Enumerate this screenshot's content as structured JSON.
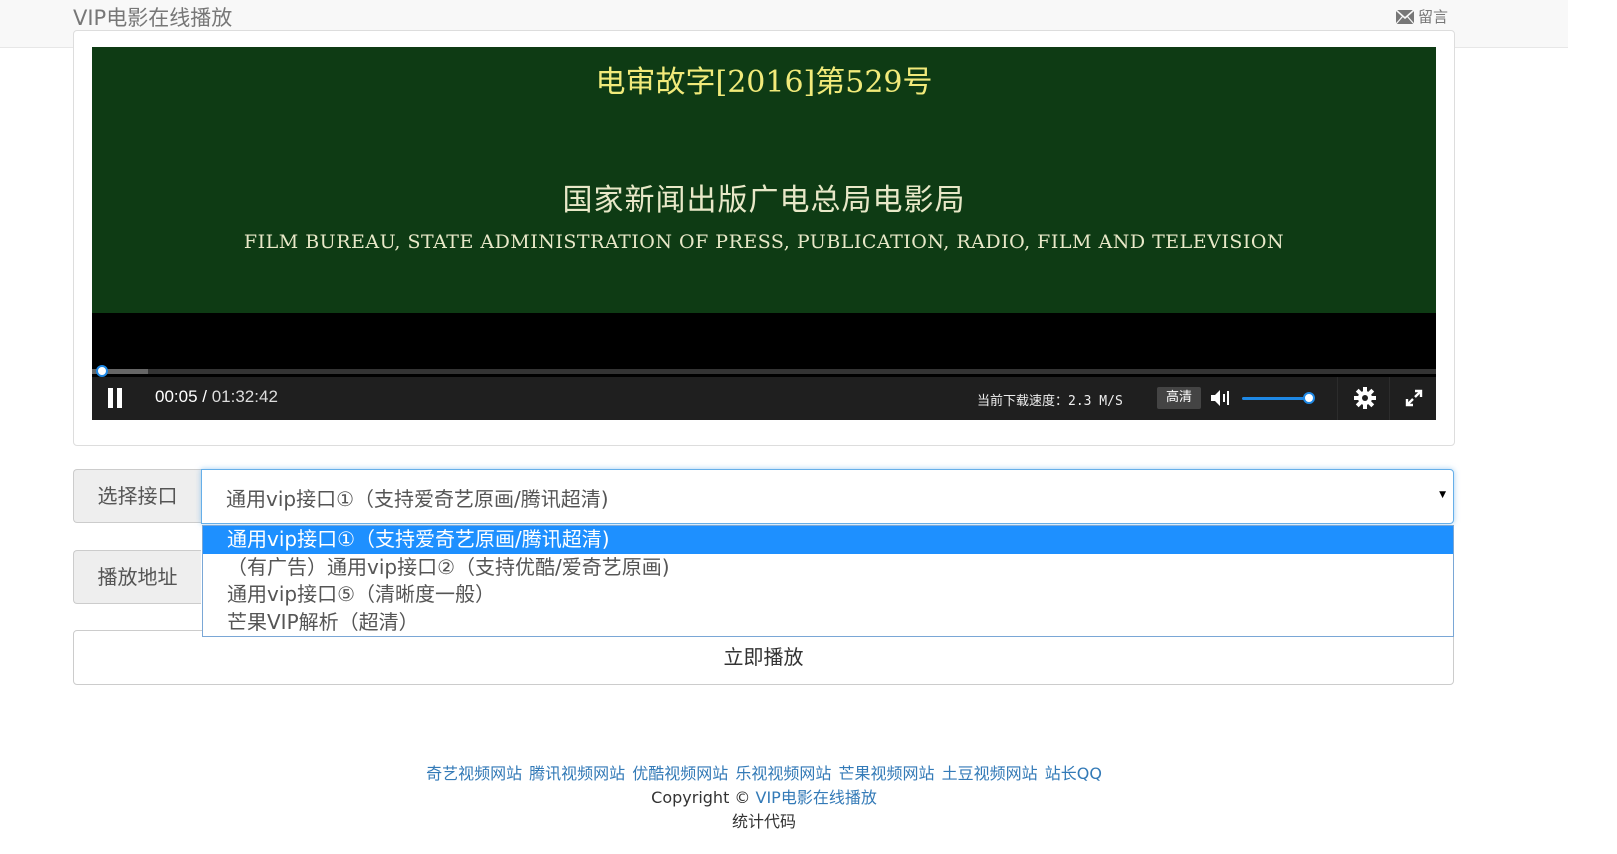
{
  "navbar": {
    "brand": "VIP电影在线播放",
    "message_label": "留言"
  },
  "player": {
    "frame_line1": "电审故字[2016]第529号",
    "frame_line2": "国家新闻出版广电总局电影局",
    "frame_line3": "FILM BUREAU, STATE ADMINISTRATION OF PRESS, PUBLICATION, RADIO, FILM AND TELEVISION",
    "current_time": "00:05",
    "time_sep": " / ",
    "total_time": "01:32:42",
    "speed_text": "当前下载速度：2.3 M/S",
    "quality_label": "高清",
    "progress_fraction": 0.001,
    "buffered_fraction": 0.042,
    "volume_fraction": 1.0
  },
  "form": {
    "interface_label": "选择接口",
    "address_label": "播放地址",
    "selected_option": "通用vip接口①（支持爱奇艺原画/腾讯超清)",
    "options": [
      "通用vip接口①（支持爱奇艺原画/腾讯超清)",
      "（有广告）通用vip接口②（支持优酷/爱奇艺原画)",
      "通用vip接口⑤（清晰度一般）",
      "芒果VIP解析（超清）"
    ],
    "play_button": "立即播放"
  },
  "footer": {
    "links": [
      "奇艺视频网站",
      "腾讯视频网站",
      "优酷视频网站",
      "乐视视频网站",
      "芒果视频网站",
      "土豆视频网站",
      "站长QQ"
    ],
    "copyright_prefix": "Copyright © ",
    "copyright_link": "VIP电影在线播放",
    "stats": "统计代码"
  },
  "icons": [
    "envelope-icon",
    "pause-icon",
    "volume-icon",
    "gear-icon",
    "fullscreen-icon",
    "caret-down-icon"
  ],
  "colors": {
    "accent": "#1e88e5",
    "selected_option_bg": "#1e90ff",
    "link": "#337ab7",
    "frame_bg": "#0e3b14"
  }
}
